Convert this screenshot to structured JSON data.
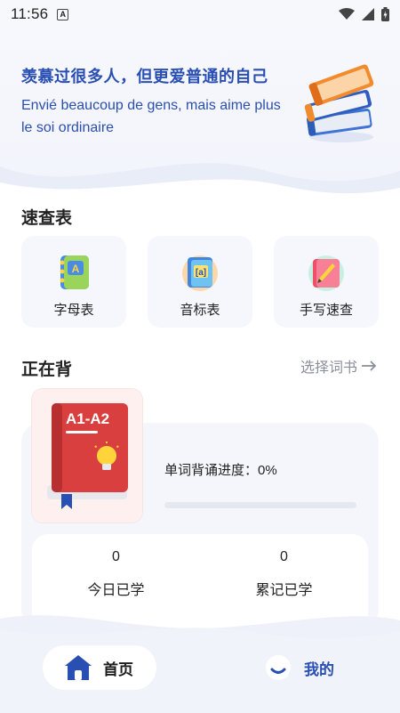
{
  "status_bar": {
    "time": "11:56",
    "notification_icon": "a-icon",
    "icons": [
      "wifi-icon",
      "signal-icon",
      "battery-icon"
    ]
  },
  "hero": {
    "title": "羡慕过很多人，但更爱普通的自己",
    "subtitle": "Envié beaucoup de gens, mais aime plus le soi ordinaire",
    "illustration": "books-stack-icon"
  },
  "quick_ref": {
    "title": "速查表",
    "cards": [
      {
        "label": "字母表",
        "icon": "alphabet-notebook-icon"
      },
      {
        "label": "音标表",
        "icon": "phonetic-book-icon"
      },
      {
        "label": "手写速查",
        "icon": "handwriting-book-icon"
      }
    ]
  },
  "studying": {
    "title": "正在背",
    "select_book": "选择词书",
    "select_book_icon": "arrow-right-icon",
    "book_level": "A1-A2",
    "progress_label": "单词背诵进度：0%",
    "progress_percent": 0,
    "stats": [
      {
        "value": "0",
        "label": "今日已学"
      },
      {
        "value": "0",
        "label": "累记已学"
      }
    ]
  },
  "bottom_nav": {
    "home": {
      "label": "首页",
      "icon": "home-icon"
    },
    "mine": {
      "label": "我的",
      "icon": "profile-icon"
    }
  },
  "colors": {
    "accent": "#2a4fb3",
    "book_red": "#d93f3f",
    "panel_bg": "#f4f6fb"
  }
}
